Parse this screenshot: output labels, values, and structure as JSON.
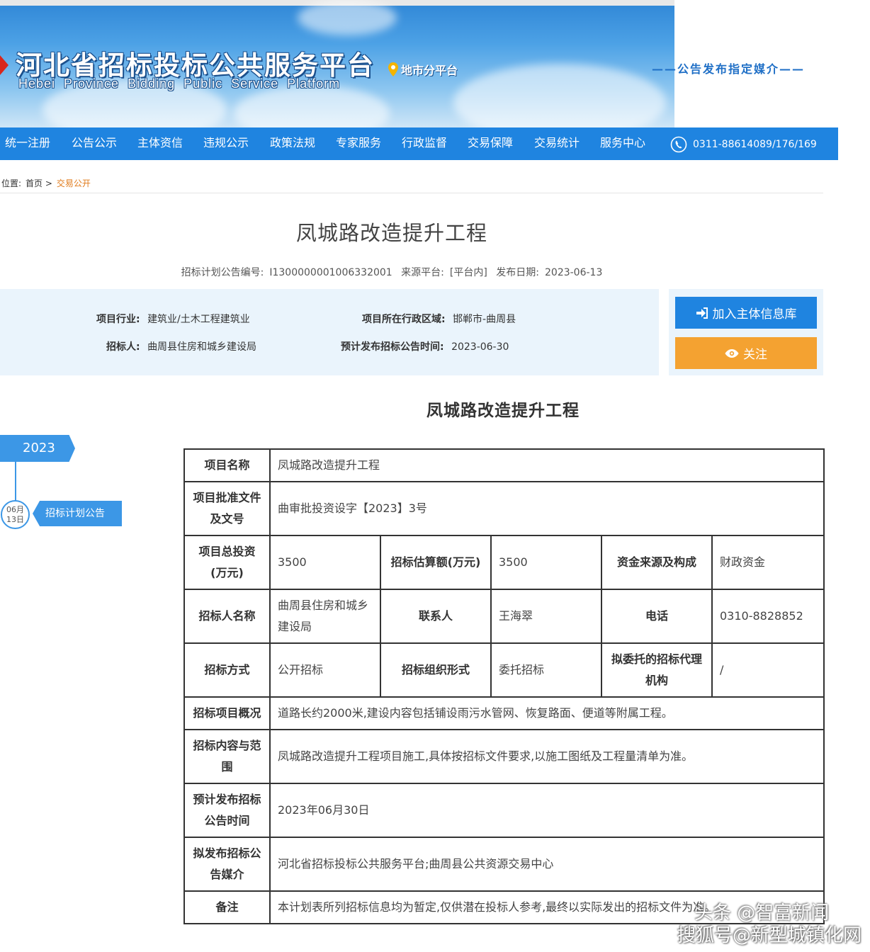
{
  "header": {
    "title": "河北省招标投标公共服务平台",
    "subtitle": "Hebei  Province  Bidding  Public  Service  Platform",
    "sub_platform": "地市分平台",
    "media_slogan": "——公告发布指定媒介——"
  },
  "nav": {
    "items": [
      "统一注册",
      "公告公示",
      "主体资信",
      "违规公示",
      "政策法规",
      "专家服务",
      "行政监督",
      "交易保障",
      "交易统计",
      "服务中心"
    ],
    "phone": "0311-88614089/176/169"
  },
  "breadcrumb": {
    "prefix": "位置:",
    "home": "首页 >",
    "current": "交易公开"
  },
  "article": {
    "title": "凤城路改造提升工程",
    "notice_no_label": "招标计划公告编号:",
    "notice_no": "I1300000001006332001",
    "source_label": "来源平台:",
    "source": "[平台内]",
    "date_label": "发布日期:",
    "date": "2023-06-13"
  },
  "info": {
    "industry_label": "项目行业:",
    "industry": "建筑业/土木工程建筑业",
    "region_label": "项目所在行政区域:",
    "region": "邯郸市-曲周县",
    "tenderer_label": "招标人:",
    "tenderer": "曲周县住房和城乡建设局",
    "expected_label": "预计发布招标公告时间:",
    "expected": "2023-06-30"
  },
  "actions": {
    "join": "加入主体信息库",
    "follow": "关注"
  },
  "section_title": "凤城路改造提升工程",
  "timeline": {
    "year": "2023",
    "month": "06月",
    "day": "13日",
    "tag": "招标计划公告"
  },
  "table": {
    "project_name_h": "项目名称",
    "project_name": "凤城路改造提升工程",
    "approval_h": "项目批准文件及文号",
    "approval": "曲审批投资设字【2023】3号",
    "total_invest_h": "项目总投资(万元)",
    "total_invest": "3500",
    "estimate_h": "招标估算额(万元)",
    "estimate": "3500",
    "fund_source_h": "资金来源及构成",
    "fund_source": "财政资金",
    "tenderer_h": "招标人名称",
    "tenderer": "曲周县住房和城乡建设局",
    "contact_h": "联系人",
    "contact": "王海翠",
    "phone_h": "电话",
    "phone": "0310-8828852",
    "method_h": "招标方式",
    "method": "公开招标",
    "org_form_h": "招标组织形式",
    "org_form": "委托招标",
    "agency_h": "拟委托的招标代理机构",
    "agency": "/",
    "overview_h": "招标项目概况",
    "overview": "道路长约2000米,建设内容包括铺设雨污水管网、恢复路面、便道等附属工程。",
    "scope_h": "招标内容与范围",
    "scope": "凤城路改造提升工程项目施工,具体按招标文件要求,以施工图纸及工程量清单为准。",
    "pub_time_h": "预计发布招标公告时间",
    "pub_time": "2023年06月30日",
    "media_h": "拟发布招标公告媒介",
    "media": "河北省招标投标公共服务平台;曲周县公共资源交易中心",
    "remark_h": "备注",
    "remark": "本计划表所列招标信息均为暂定,仅供潜在投标人参考,最终以实际发出的招标文件为准。"
  },
  "watermark": {
    "line1": "头条 @智富新闻",
    "line2": "搜狐号@新型城镇化网"
  },
  "colors": {
    "nav_blue": "#1f84e0",
    "follow_orange": "#f4a231",
    "info_bg": "#eaf4fc",
    "breadcrumb_current": "#e07b1c"
  }
}
